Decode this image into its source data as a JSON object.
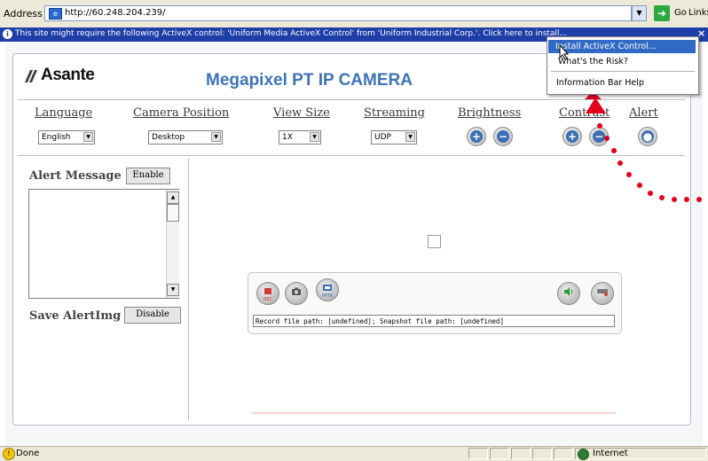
{
  "browser": {
    "address_label": "Address",
    "url": "http://60.248.204.239/",
    "go_label": "Go",
    "links_label": "Links"
  },
  "infobar": {
    "message": "This site might require the following ActiveX control: 'Uniform Media ActiveX Control' from 'Uniform Industrial Corp.'. Click here to install..."
  },
  "popup_menu": {
    "items": [
      "Install ActiveX Control...",
      "What's the Risk?",
      "Information Bar Help"
    ],
    "selected_index": 0
  },
  "page": {
    "logo_text": "Asante",
    "title": "Megapixel PT IP CAMERA"
  },
  "controls": {
    "language": {
      "label": "Language",
      "value": "English"
    },
    "camera_position": {
      "label": "Camera Position",
      "value": "Desktop"
    },
    "view_size": {
      "label": "View Size",
      "value": "1X"
    },
    "streaming": {
      "label": "Streaming",
      "value": "UDP"
    },
    "brightness": {
      "label": "Brightness"
    },
    "contrast": {
      "label": "Contrast"
    },
    "alert": {
      "label": "Alert"
    }
  },
  "sidebar": {
    "alert_message_label": "Alert Message",
    "enable_label": "Enable",
    "save_alert_label": "Save AlertImg",
    "disable_label": "Disable"
  },
  "media": {
    "rec_label": "REC",
    "ptz_label": "PRTK",
    "path_text": "Record file path: [undefined]; Snapshot file path: [undefined]"
  },
  "statusbar": {
    "status": "Done",
    "zone": "Internet"
  },
  "colors": {
    "infobar": "#1f3fa8",
    "title_blue": "#3d74b8",
    "annotation_red": "#e3001b",
    "menu_highlight": "#316ac5"
  }
}
